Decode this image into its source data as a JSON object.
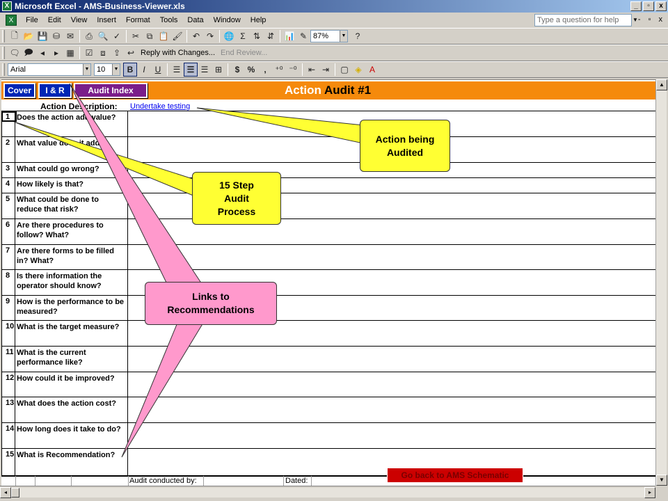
{
  "window": {
    "title": "Microsoft Excel - AMS-Business-Viewer.xls",
    "controls": [
      "_",
      "▫",
      "x"
    ]
  },
  "menu": {
    "items": [
      "File",
      "Edit",
      "View",
      "Insert",
      "Format",
      "Tools",
      "Data",
      "Window",
      "Help"
    ],
    "help_placeholder": "Type a question for help",
    "window_controls": "- ▫ x"
  },
  "toolbar": {
    "zoom": "87%",
    "reply_label": "Reply with Changes...",
    "end_review_label": "End Review...",
    "font": "Arial",
    "font_size": "10",
    "bold": "B",
    "italic": "I",
    "underline": "U",
    "currency": "$",
    "percent": "%",
    "comma": ","
  },
  "sheet": {
    "nav": {
      "cover": "Cover",
      "ir": "I & R",
      "audit_index": "Audit Index"
    },
    "title_highlight": "Action",
    "title_rest": " Audit #1",
    "description_label": "Action Description:",
    "description_link": "Undertake testing",
    "questions": [
      {
        "num": "1",
        "text": "Does the action add value?"
      },
      {
        "num": "2",
        "text": "What value does it add?"
      },
      {
        "num": "3",
        "text": "What could go wrong?"
      },
      {
        "num": "4",
        "text": "How likely is that?"
      },
      {
        "num": "5",
        "text": "What could be done to reduce that risk?"
      },
      {
        "num": "6",
        "text": "Are there procedures to follow? What?"
      },
      {
        "num": "7",
        "text": "Are there forms to be filled in? What?"
      },
      {
        "num": "8",
        "text": "Is there information the operator should know?"
      },
      {
        "num": "9",
        "text": "How is the performance to be measured?"
      },
      {
        "num": "10",
        "text": "What is the target measure?"
      },
      {
        "num": "11",
        "text": "What is the current performance like?"
      },
      {
        "num": "12",
        "text": "How could it be improved?"
      },
      {
        "num": "13",
        "text": "What does the action cost?"
      },
      {
        "num": "14",
        "text": "How long does it take to do?"
      },
      {
        "num": "15",
        "text": "What is Recommendation?"
      }
    ],
    "footer_conducted": "Audit conducted by:",
    "footer_dated": "Dated:",
    "goback": "Go back to AMS Schematic"
  },
  "callouts": {
    "action_audited": "Action being Audited",
    "step_process": "15 Step Audit Process",
    "links_recs": "Links to Recommendations"
  },
  "colors": {
    "header_orange": "#f58a0c",
    "nav_blue": "#0026b5",
    "nav_purple": "#7a1d8a",
    "callout_yellow": "#ffff33",
    "callout_pink": "#ff99cc"
  }
}
